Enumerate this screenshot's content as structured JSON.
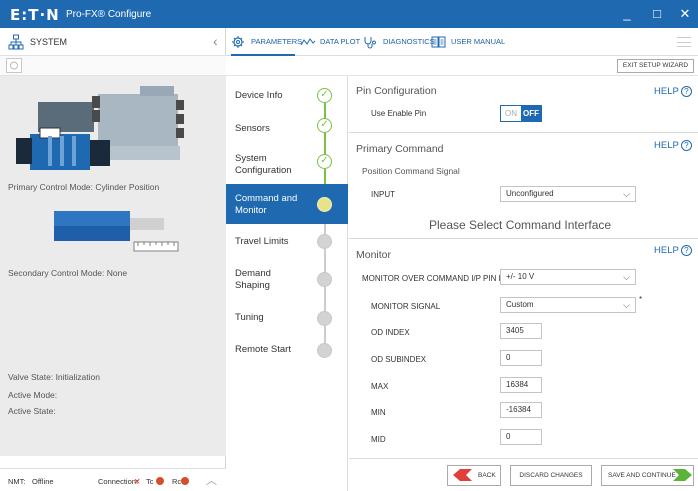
{
  "window": {
    "logo": "E:T·N",
    "title": "Pro-FX® Configure",
    "min_glyph": "_",
    "max_glyph": "□",
    "close_glyph": "✕"
  },
  "left_panel": {
    "title": "SYSTEM",
    "primary_mode": "Primary Control Mode: Cylinder Position",
    "secondary_mode": "Secondary Control Mode: None",
    "valve_state": "Valve State:  Initialization",
    "active_mode": "Active Mode:",
    "active_state": "Active State:",
    "footer": {
      "nmt_label": "NMT:",
      "nmt_value": "Offline",
      "connection_label": "Connection:",
      "connection_mark": "✕",
      "tc_label": "Tc",
      "rc_label": "Rc"
    }
  },
  "tabs": [
    {
      "label": "PARAMETERS"
    },
    {
      "label": "DATA PLOT"
    },
    {
      "label": "DIAGNOSTICS"
    },
    {
      "label": "USER MANUAL"
    }
  ],
  "exit_setup_wizard": "EXIT SETUP WIZARD",
  "steps": [
    {
      "label": "Device Info",
      "status": "done"
    },
    {
      "label": "Sensors",
      "status": "done"
    },
    {
      "label": "System Configuration",
      "status": "done"
    },
    {
      "label": "Command and Monitor",
      "status": "active"
    },
    {
      "label": "Travel Limits",
      "status": "pending"
    },
    {
      "label": "Demand Shaping",
      "status": "pending"
    },
    {
      "label": "Tuning",
      "status": "pending"
    },
    {
      "label": "Remote Start",
      "status": "pending"
    }
  ],
  "help_label": "HELP",
  "pin_config": {
    "title": "Pin Configuration",
    "use_enable_pin": "Use Enable Pin",
    "toggle_on": "ON",
    "toggle_off": "OFF"
  },
  "primary_command": {
    "title": "Primary Command",
    "subtitle": "Position Command Signal",
    "input_label": "INPUT",
    "input_value": "Unconfigured",
    "message": "Please Select Command Interface"
  },
  "monitor": {
    "title": "Monitor",
    "fields": {
      "monitor_over": {
        "label": "MONITOR OVER COMMAND I/P PIN F",
        "value": "+/- 10 V"
      },
      "monitor_signal": {
        "label": "MONITOR SIGNAL",
        "value": "Custom"
      },
      "od_index": {
        "label": "OD INDEX",
        "value": "3405"
      },
      "od_subindex": {
        "label": "OD SUBINDEX",
        "value": "0"
      },
      "max": {
        "label": "MAX",
        "value": "16384"
      },
      "min": {
        "label": "MIN",
        "value": "-16384"
      },
      "mid": {
        "label": "MID",
        "value": "0"
      }
    },
    "asterisk": "*"
  },
  "footer_buttons": {
    "back": "BACK",
    "discard": "DISCARD CHANGES",
    "save_continue": "SAVE AND CONTINUE"
  },
  "colors": {
    "brand_blue": "#1f69b1",
    "done_green": "#7cc242",
    "status_red": "#d74c2b"
  }
}
